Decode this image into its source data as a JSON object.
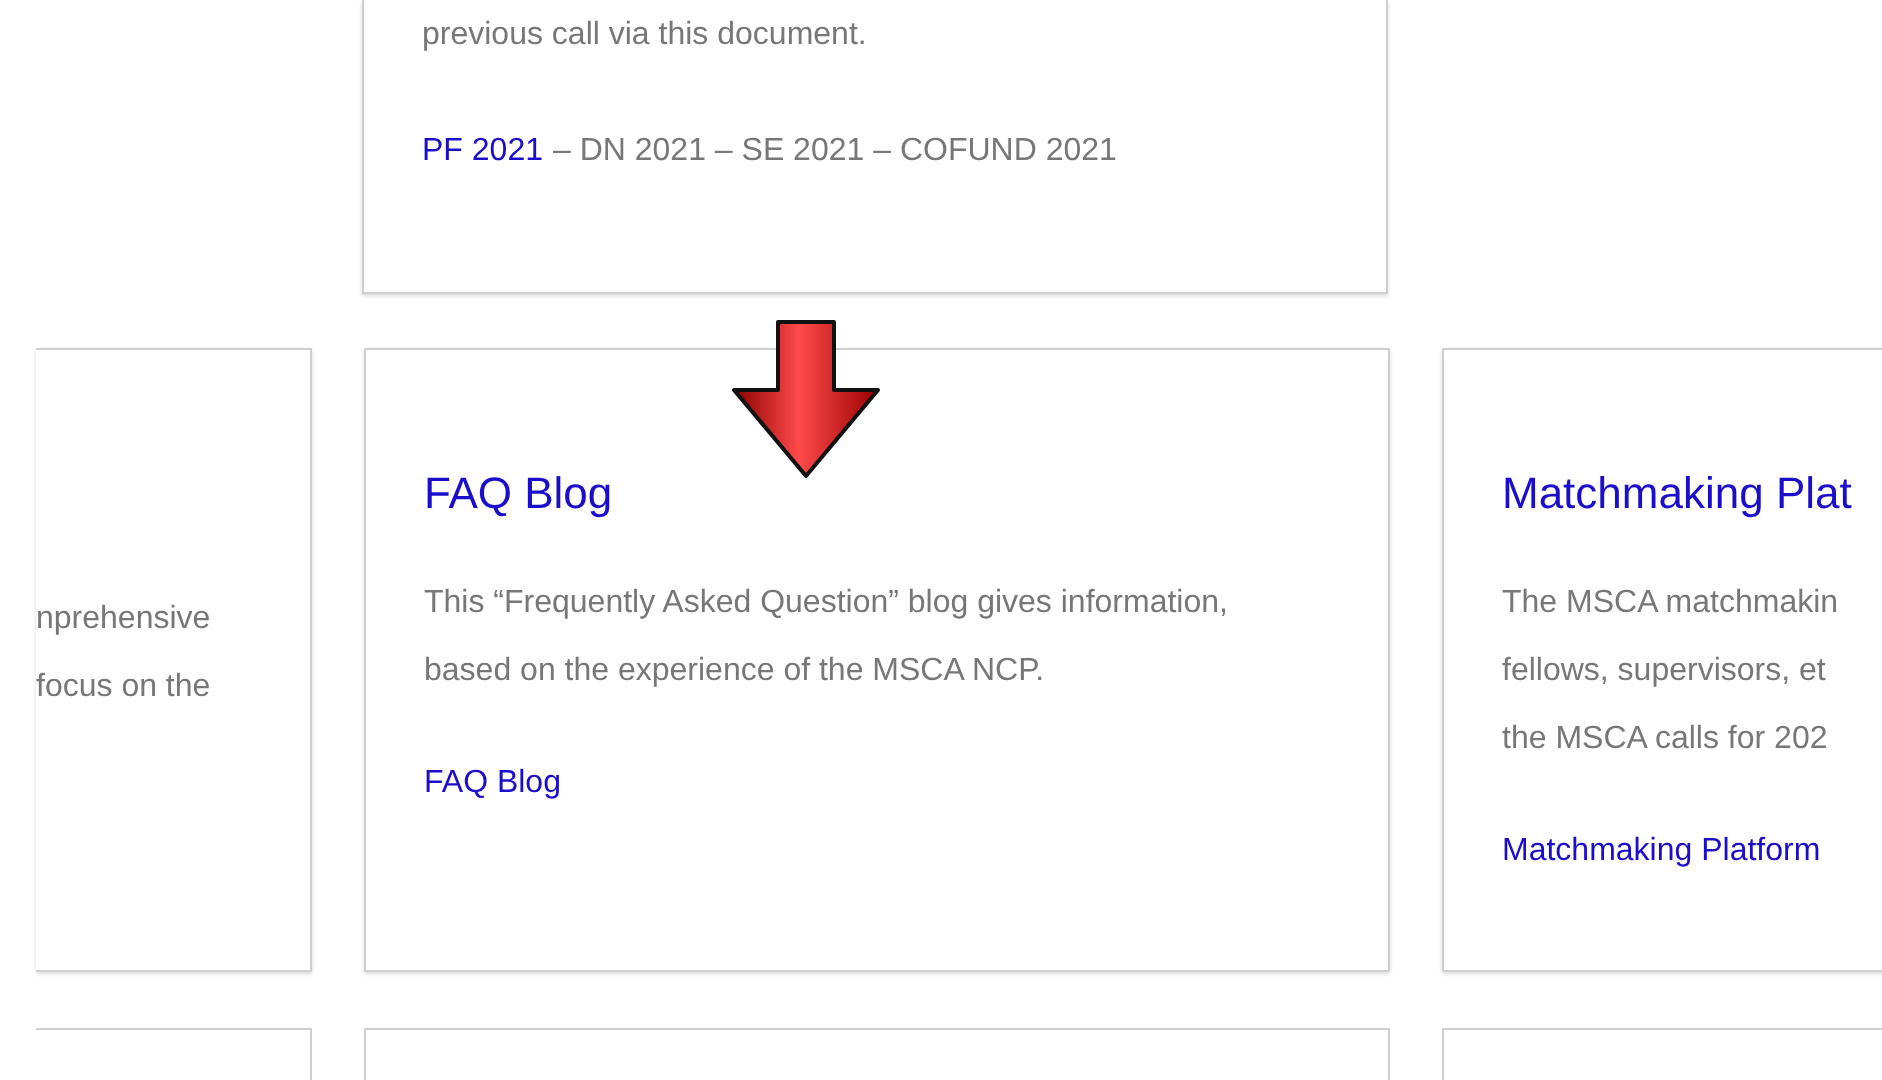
{
  "top_card": {
    "description": "previous call via this document.",
    "call_links": [
      {
        "kind": "link",
        "label": "PF 2021"
      },
      {
        "kind": "text",
        "label": "– DN 2021 – SE 2021 – COFUND 2021"
      }
    ]
  },
  "cards": [
    {
      "kind": "clipped-left",
      "lines": [
        "nprehensive",
        "focus on the"
      ]
    },
    {
      "kind": "full",
      "title": "FAQ Blog",
      "description": "This “Frequently Asked Question” blog gives information, based on the experience of the MSCA NCP.",
      "link": "FAQ Blog"
    },
    {
      "kind": "clipped-right",
      "title": "Matchmaking Plat",
      "lines": [
        "The MSCA matchmakin",
        "fellows, supervisors, et",
        "the MSCA calls for 202"
      ],
      "link": "Matchmaking Platform"
    }
  ]
}
